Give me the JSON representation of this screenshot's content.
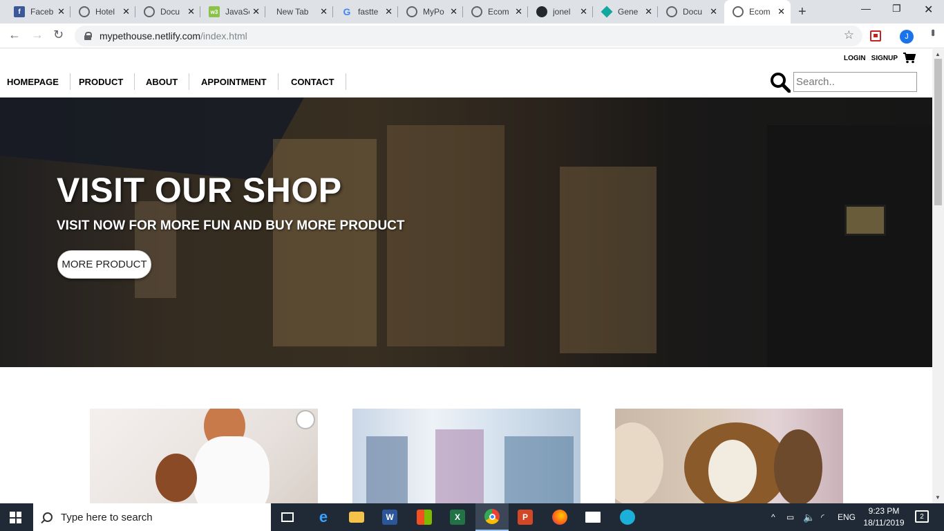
{
  "browser": {
    "tabs": [
      {
        "title": "Faceb",
        "icon": "facebook-icon"
      },
      {
        "title": "Hotel",
        "icon": "globe-icon"
      },
      {
        "title": "Docu",
        "icon": "globe-icon"
      },
      {
        "title": "JavaSc",
        "icon": "w3schools-icon"
      },
      {
        "title": "New Tab",
        "icon": ""
      },
      {
        "title": "fastte",
        "icon": "google-icon"
      },
      {
        "title": "MyPo",
        "icon": "globe-icon"
      },
      {
        "title": "Ecom",
        "icon": "globe-icon"
      },
      {
        "title": "jonel",
        "icon": "github-icon"
      },
      {
        "title": "Gene",
        "icon": "diamond-icon"
      },
      {
        "title": "Docu",
        "icon": "globe-icon"
      },
      {
        "title": "Ecom",
        "icon": "globe-icon"
      }
    ],
    "url_host": "mypethouse.netlify.com",
    "url_path": "/index.html",
    "profile_initial": "J"
  },
  "page": {
    "top_links": {
      "login": "LOGIN",
      "signup": "SIGNUP"
    },
    "nav": [
      "HOMEPAGE",
      "PRODUCT",
      "ABOUT",
      "APPOINTMENT",
      "CONTACT"
    ],
    "search_placeholder": "Search..",
    "hero": {
      "title": "VISIT OUR SHOP",
      "subtitle": "VISIT NOW FOR MORE FUN AND BUY MORE PRODUCT",
      "button": "MORE PRODUCT"
    }
  },
  "taskbar": {
    "search_placeholder": "Type here to search",
    "language": "ENG",
    "time": "9:23 PM",
    "date": "18/11/2019",
    "notifications": "2"
  },
  "colors": {
    "tabstrip": "#dee1e6",
    "taskbar": "#1f2a36",
    "profile": "#1a73e8"
  }
}
